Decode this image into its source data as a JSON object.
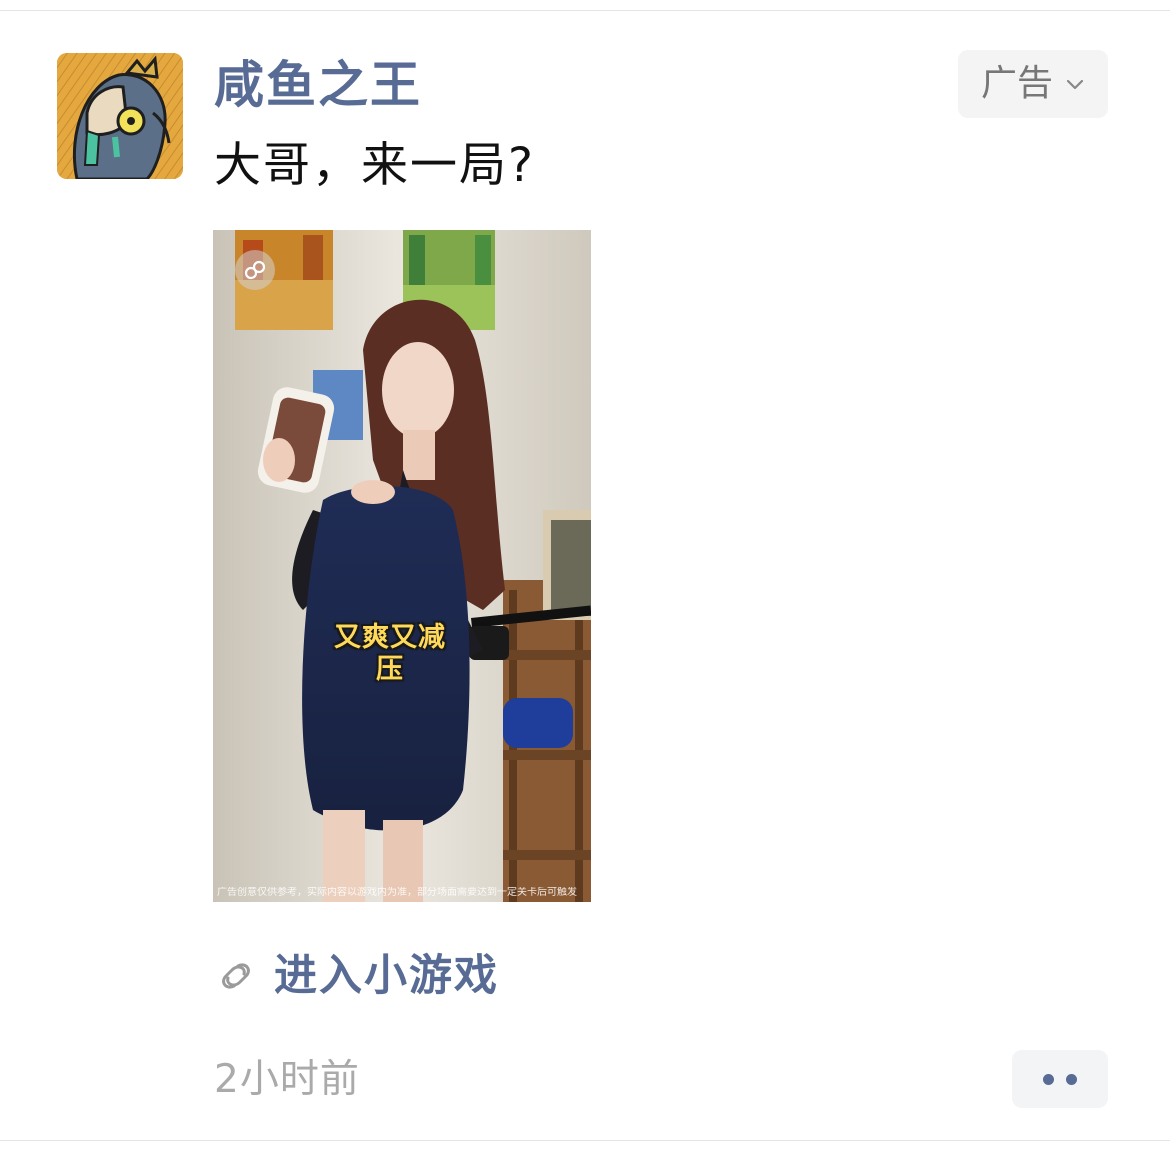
{
  "post": {
    "account_name": "咸鱼之王",
    "text": "大哥，来一局?",
    "ad_label": "广告",
    "media": {
      "caption": "又爽又减压",
      "disclaimer": "广告创意仅供参考，实际内容以游戏内为准，部分场面需要达到一定关卡后可触发"
    },
    "link_label": "进入小游戏",
    "timestamp": "2小时前"
  },
  "colors": {
    "link_blue": "#576b95",
    "caption_yellow": "#ffd95a",
    "timestamp_gray": "#aaaaaa"
  },
  "icons": {
    "avatar": "salted-fish-king-avatar",
    "ad_menu": "chevron-down-icon",
    "mini_program": "mini-program-icon",
    "more": "more-dots-icon"
  }
}
